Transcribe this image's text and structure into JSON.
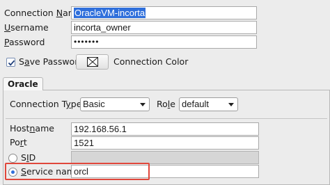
{
  "connection": {
    "name_label": "Connection Name",
    "name_value": "OracleVM-incorta",
    "username_label": "Username",
    "username_value": "incorta_owner",
    "password_label": "Password",
    "password_value": "•••••••",
    "save_password_label": "Save Password",
    "save_password_checked": true,
    "color_label": "Connection Color"
  },
  "tabs": [
    {
      "label": "Oracle",
      "selected": true
    }
  ],
  "oracle": {
    "type_label": "Connection Type",
    "type_value": "Basic",
    "role_label": "Role",
    "role_value": "default",
    "hostname_label": "Hostname",
    "hostname_value": "192.168.56.1",
    "port_label": "Port",
    "port_value": "1521",
    "sid_label": "SID",
    "sid_value": "",
    "service_label": "Service name",
    "service_value": "orcl",
    "selected_option": "service_name"
  },
  "colors": {
    "selection": "#2f6fdb",
    "highlight": "#e0473b"
  }
}
